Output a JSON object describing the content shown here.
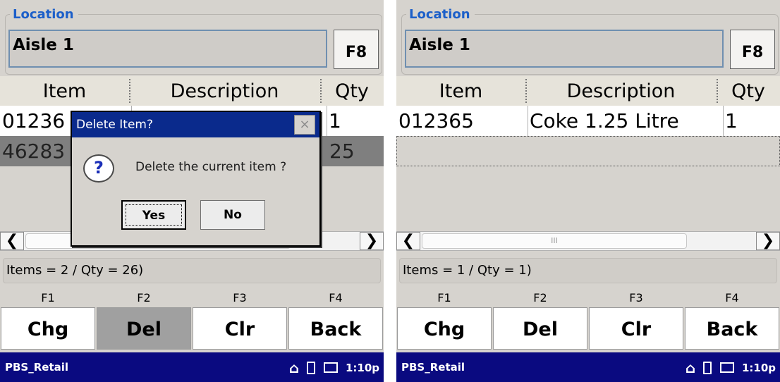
{
  "screens": [
    {
      "location_label": "Location",
      "location_value": "Aisle 1",
      "f8_label": "F8",
      "columns": [
        "Item",
        "Description",
        "Qty"
      ],
      "rows": [
        {
          "item": "01236",
          "description": "",
          "qty": "1"
        },
        {
          "item": "46283",
          "description": "",
          "qty": "25"
        }
      ],
      "status": "Items = 2 / Qty = 26)",
      "fkeys": [
        "F1",
        "F2",
        "F3",
        "F4"
      ],
      "buttons": [
        "Chg",
        "Del",
        "Clr",
        "Back"
      ],
      "taskbar": {
        "app": "PBS_Retail",
        "time": "1:10p"
      },
      "dialog": {
        "title": "Delete Item?",
        "close": "×",
        "icon": "?",
        "message": "Delete the current item ?",
        "yes": "Yes",
        "no": "No"
      }
    },
    {
      "location_label": "Location",
      "location_value": "Aisle 1",
      "f8_label": "F8",
      "columns": [
        "Item",
        "Description",
        "Qty"
      ],
      "rows": [
        {
          "item": "012365",
          "description": "Coke 1.25 Litre",
          "qty": "1"
        }
      ],
      "scroll_grip": "III",
      "status": "Items = 1 / Qty = 1)",
      "fkeys": [
        "F1",
        "F2",
        "F3",
        "F4"
      ],
      "buttons": [
        "Chg",
        "Del",
        "Clr",
        "Back"
      ],
      "taskbar": {
        "app": "PBS_Retail",
        "time": "1:10p"
      }
    }
  ],
  "colors": {
    "accent": "#1c5fc9",
    "taskbar": "#0a0a80",
    "dialog_title": "#0a2a8c",
    "pressed": "#a0a0a0"
  },
  "icons": {
    "scroll_left": "chevron-left-icon",
    "scroll_right": "chevron-right-icon",
    "home": "home-icon",
    "battery": "battery-icon",
    "keyboard": "keyboard-icon",
    "question": "question-icon",
    "close": "close-icon"
  }
}
